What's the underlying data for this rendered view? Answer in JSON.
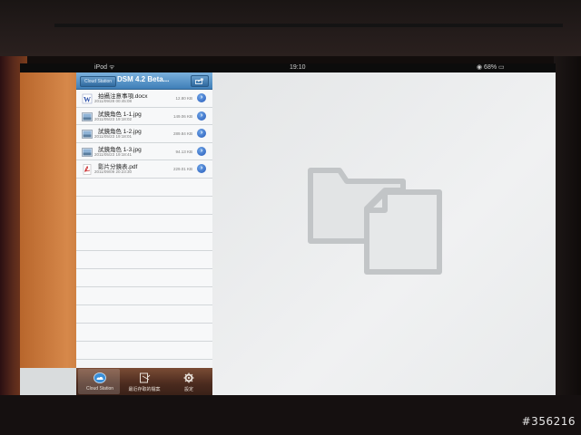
{
  "statusbar": {
    "carrier": "iPod ᯤ",
    "time": "19:10",
    "battery": "◉ 68% ▭"
  },
  "navbar": {
    "back_label": "Cloud Station",
    "title": "DSM 4.2 Beta..."
  },
  "files": [
    {
      "name": "拍攝注意事項.docx",
      "date": "2011/09/28 00:45:08",
      "size": "12.80 KB",
      "type": "docx",
      "icon": "word-document-icon"
    },
    {
      "name": "試鏡角色 1-1.jpg",
      "date": "2011/05/23 19:18:02",
      "size": "149.06 KB",
      "type": "jpg",
      "icon": "image-file-icon"
    },
    {
      "name": "試鏡角色 1-2.jpg",
      "date": "2011/05/23 19:18:01",
      "size": "289.84 KB",
      "type": "jpg",
      "icon": "image-file-icon"
    },
    {
      "name": "試鏡角色 1-3.jpg",
      "date": "2011/05/23 19:18:41",
      "size": "94.13 KB",
      "type": "jpg",
      "icon": "image-file-icon"
    },
    {
      "name": "影片分鏡表.pdf",
      "date": "2011/09/09 20:23:30",
      "size": "229.01 KB",
      "type": "pdf",
      "icon": "pdf-file-icon"
    }
  ],
  "tabbar": {
    "tabs": [
      {
        "label": "Cloud Station",
        "icon": "cloud-icon",
        "selected": true
      },
      {
        "label": "最近存取的檔案",
        "icon": "recent-files-icon",
        "selected": false
      },
      {
        "label": "設定",
        "icon": "gear-icon",
        "selected": false
      }
    ]
  },
  "detail": {
    "placeholder_icon": "folder-and-file-icon"
  },
  "watermark": "#356216",
  "colors": {
    "navbar": "#3f7fb8",
    "tabbar": "#4a2a1e",
    "disclosure": "#2458b8"
  }
}
